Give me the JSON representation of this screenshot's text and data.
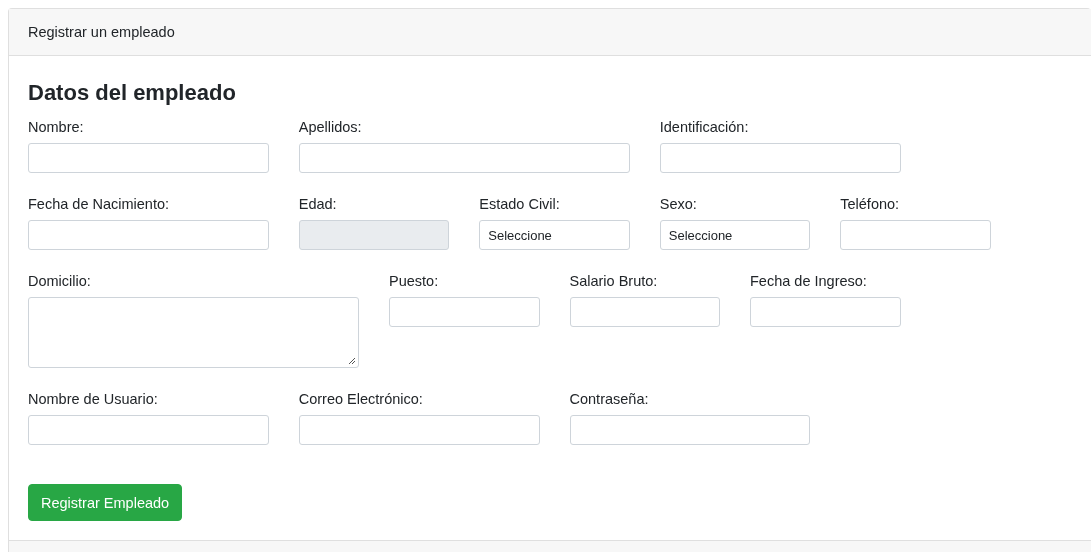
{
  "card": {
    "header": "Registrar un empleado",
    "title": "Datos del empleado",
    "rows": [
      [
        {
          "label": "Nombre:",
          "kind": "text",
          "disabled": false
        },
        {
          "label": "Apellidos:",
          "kind": "text",
          "disabled": false
        },
        {
          "label": "Identificación:",
          "kind": "text",
          "disabled": false
        }
      ],
      [
        {
          "label": "Fecha de Nacimiento:",
          "kind": "text",
          "disabled": false
        },
        {
          "label": "Edad:",
          "kind": "text",
          "disabled": true
        },
        {
          "label": "Estado Civil:",
          "kind": "select",
          "value": "Seleccione",
          "disabled": false
        },
        {
          "label": "Sexo:",
          "kind": "select",
          "value": "Seleccione",
          "disabled": false
        },
        {
          "label": "Teléfono:",
          "kind": "text",
          "disabled": false
        }
      ],
      [
        {
          "label": "Domicilio:",
          "kind": "textarea",
          "disabled": false
        },
        {
          "label": "Puesto:",
          "kind": "text",
          "disabled": false
        },
        {
          "label": "Salario Bruto:",
          "kind": "text",
          "disabled": false
        },
        {
          "label": "Fecha de Ingreso:",
          "kind": "text",
          "disabled": false
        }
      ],
      [
        {
          "label": "Nombre de Usuario:",
          "kind": "text",
          "disabled": false
        },
        {
          "label": "Correo Electrónico:",
          "kind": "text",
          "disabled": false
        },
        {
          "label": "Contraseña:",
          "kind": "text",
          "disabled": false
        }
      ]
    ],
    "button": "Registrar Empleado"
  }
}
